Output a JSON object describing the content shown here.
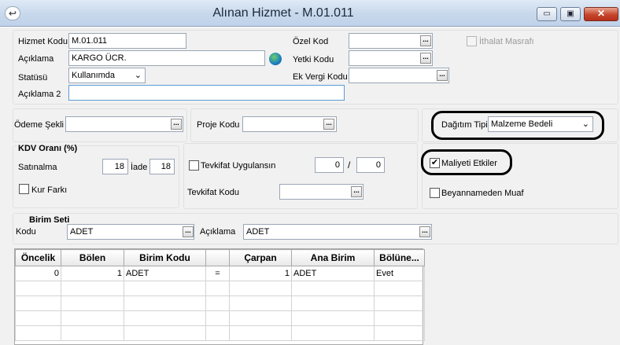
{
  "window": {
    "title": "Alınan Hizmet - M.01.011",
    "minimize_glyph": "▭",
    "maximize_glyph": "▣",
    "close_glyph": "✕",
    "app_icon_glyph": "↩"
  },
  "header_form": {
    "hizmet_kodu_label": "Hizmet Kodu",
    "hizmet_kodu_value": "M.01.011",
    "aciklama_label": "Açıklama",
    "aciklama_value": "KARGO ÜCR.",
    "statusu_label": "Statüsü",
    "statusu_value": "Kullanımda",
    "aciklama2_label": "Açıklama 2",
    "aciklama2_value": "",
    "ozel_kod_label": "Özel Kod",
    "ozel_kod_value": "",
    "yetki_kodu_label": "Yetki Kodu",
    "yetki_kodu_value": "",
    "ek_vergi_kodu_label": "Ek Vergi Kodu",
    "ek_vergi_kodu_value": "",
    "ithalat_masrafi_label": "İthalat Masrafı",
    "ithalat_masrafi_checked": false
  },
  "row2": {
    "odeme_sekli_label": "Ödeme Şekli",
    "odeme_sekli_value": "",
    "proje_kodu_label": "Proje Kodu",
    "proje_kodu_value": "",
    "dagitim_tipi_label": "Dağıtım Tipi",
    "dagitim_tipi_value": "Malzeme Bedeli"
  },
  "kdv": {
    "title": "KDV Oranı (%)",
    "satinalma_label": "Satınalma",
    "satinalma_value": "18",
    "iade_label": "İade",
    "iade_value": "18",
    "kur_farki_label": "Kur Farkı",
    "kur_farki_checked": false
  },
  "tevkifat": {
    "uygulansin_label": "Tevkifat Uygulansın",
    "uygulansin_checked": false,
    "num1": "0",
    "separator": "/",
    "num2": "0",
    "kodu_label": "Tevkifat Kodu",
    "kodu_value": ""
  },
  "flags": {
    "maliyeti_etkiler_label": "Maliyeti Etkiler",
    "maliyeti_etkiler_checked": true,
    "beyannameden_muaf_label": "Beyannameden Muaf",
    "beyannameden_muaf_checked": false
  },
  "birim_seti": {
    "title": "Birim Seti",
    "kodu_label": "Kodu",
    "kodu_value": "ADET",
    "aciklama_label": "Açıklama",
    "aciklama_value": "ADET"
  },
  "lookup_glyph": "...",
  "check_glyph": "✔",
  "dropdown_glyph": "⌄",
  "units_table": {
    "columns": [
      "Öncelik",
      "Bölen",
      "Birim Kodu",
      "",
      "Çarpan",
      "Ana Birim",
      "Bölüne..."
    ],
    "rows": [
      [
        "0",
        "1",
        "ADET",
        "=",
        "1",
        "ADET",
        "Evet"
      ]
    ]
  }
}
